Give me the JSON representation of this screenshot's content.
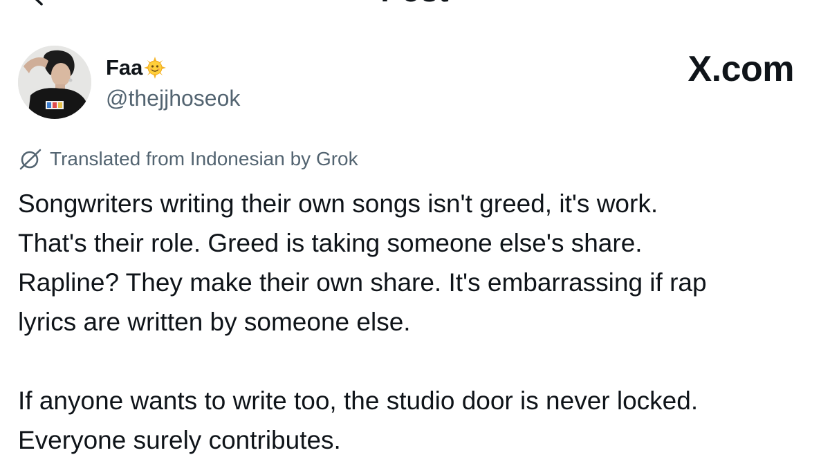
{
  "header": {
    "title": "Post"
  },
  "author": {
    "display_name": "Faa",
    "name_emoji": "sun-with-face",
    "handle": "@thejjhoseok"
  },
  "brand": {
    "watermark": "X.com"
  },
  "translation": {
    "icon": "grok-icon",
    "notice": "Translated from Indonesian by Grok"
  },
  "post": {
    "paragraph_1_lines": [
      "Songwriters writing their own songs isn't greed, it's work.",
      "That's their role. Greed is taking someone else's share.",
      "Rapline? They make their own share. It's embarrassing if rap",
      "lyrics are written by someone else."
    ],
    "paragraph_2_lines": [
      "If anyone wants to write too, the studio door is never locked.",
      "Everyone surely contributes."
    ]
  },
  "colors": {
    "text_primary": "#0f1419",
    "text_secondary": "#536471",
    "background": "#ffffff"
  }
}
